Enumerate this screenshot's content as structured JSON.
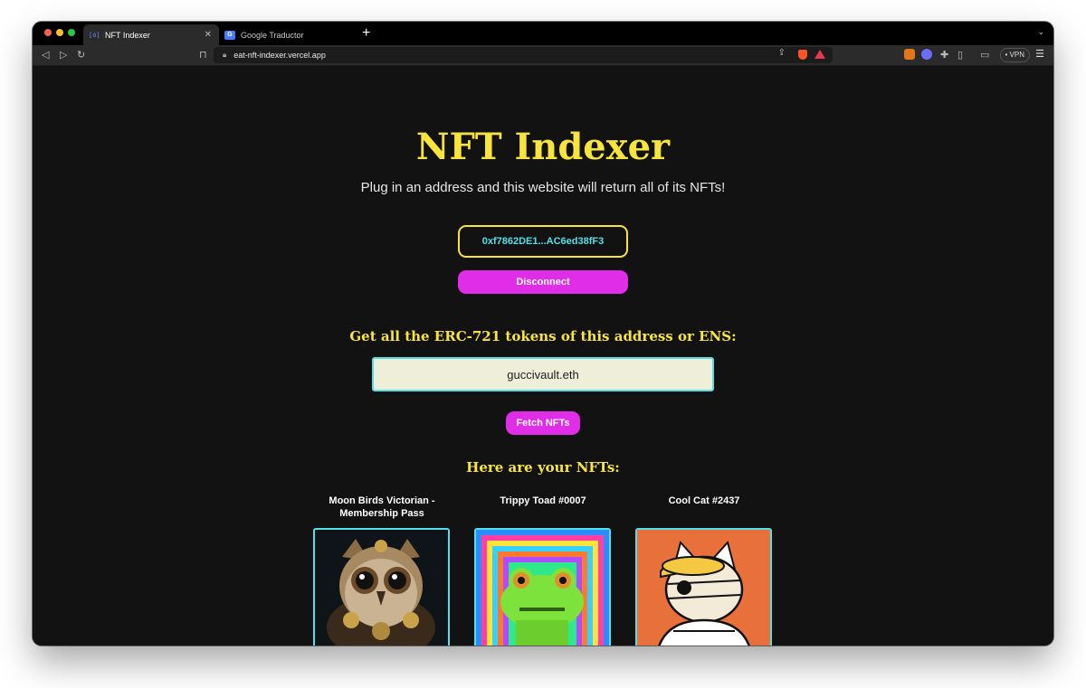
{
  "browser": {
    "tabs": [
      {
        "label": "NFT Indexer",
        "favicon": "[ó]"
      },
      {
        "label": "Google Traductor",
        "favicon": "G"
      }
    ],
    "url": "eat-nft-indexer.vercel.app",
    "vpn_label": "VPN"
  },
  "page": {
    "title": "NFT Indexer",
    "subtitle": "Plug in an address and this website will return all of its NFTs!",
    "wallet_address": "0xf7862DE1...AC6ed38fF3",
    "disconnect_label": "Disconnect",
    "search_heading": "Get all the ERC-721 tokens of this address or ENS:",
    "search_value": "guccivault.eth",
    "fetch_label": "Fetch NFTs",
    "results_heading": "Here are your NFTs:"
  },
  "nfts": [
    {
      "name": "Moon Birds Victorian - Membership Pass",
      "image": "owl-illustration"
    },
    {
      "name": "Trippy Toad #0007",
      "image": "pixel-toad"
    },
    {
      "name": "Cool Cat #2437",
      "image": "mummy-cat"
    }
  ],
  "colors": {
    "background": "#121212",
    "accent_yellow": "#f7e53b",
    "accent_magenta": "#e02de8",
    "accent_cyan": "#55e0e8"
  }
}
